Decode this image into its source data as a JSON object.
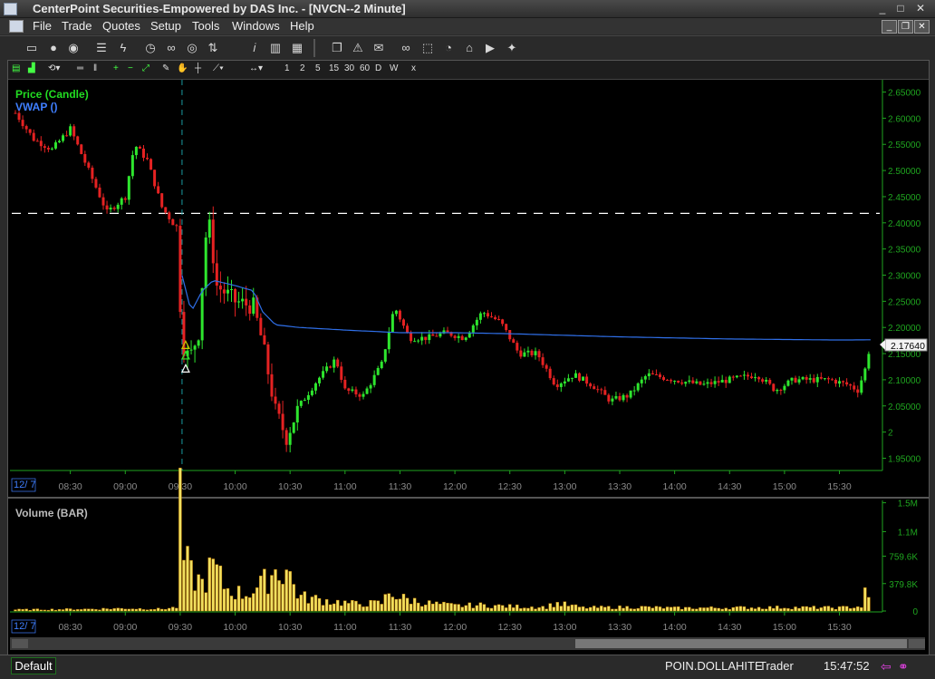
{
  "window": {
    "title": "CenterPoint Securities-Empowered by DAS Inc. - [NVCN--2 Minute]",
    "controls": [
      "_",
      "□",
      "✕"
    ]
  },
  "menu": [
    "File",
    "Trade",
    "Quotes",
    "Setup",
    "Tools",
    "Windows",
    "Help"
  ],
  "toolbar_icons": [
    "window-icon",
    "user-icon",
    "globe-icon",
    "list-icon",
    "lightning-icon",
    "clock-icon",
    "link-icon",
    "eye-icon",
    "sort-icon",
    "info-icon",
    "bar-chart-icon",
    "copy-icon",
    "alert-icon",
    "mail-icon",
    "binoculars-icon",
    "selection-icon",
    "timer-icon",
    "home-icon",
    "youtube-icon",
    "twitter-icon"
  ],
  "chart_toolbar": {
    "intervals": [
      "1",
      "2",
      "5",
      "15",
      "30",
      "60",
      "D",
      "W"
    ],
    "close": "x"
  },
  "colors": {
    "up": "#2ee62e",
    "down": "#e52222",
    "vwap": "#2f6fe8",
    "volume": "#f0e060",
    "axis": "#1fa51f",
    "legend_price": "#22dd22",
    "legend_vwap": "#3f7fff",
    "background": "#000000"
  },
  "price_pane": {
    "legend": [
      "Price (Candle)",
      "VWAP ()"
    ],
    "date_label": "12/ 7",
    "last_price": "2.17640",
    "dashed_level": 2.418,
    "crosshair_time": "09:31"
  },
  "volume_pane": {
    "legend": "Volume (BAR)",
    "date_label": "12/ 7"
  },
  "status": {
    "tab": "Default",
    "user": "POIN.DOLLAHITE",
    "role": "Trader",
    "time": "15:47:52"
  },
  "chart_data": [
    {
      "type": "candlestick",
      "series": [
        {
          "name": "Price (Candle)"
        },
        {
          "name": "VWAP ()"
        }
      ],
      "x_ticks": [
        "08:30",
        "09:00",
        "09:30",
        "10:00",
        "10:30",
        "11:00",
        "11:30",
        "12:00",
        "12:30",
        "13:00",
        "13:30",
        "14:00",
        "14:30",
        "15:00",
        "15:30"
      ],
      "y_ticks": [
        1.95,
        2,
        2.05,
        2.1,
        2.15,
        2.2,
        2.25,
        2.3,
        2.35,
        2.4,
        2.45,
        2.5,
        2.55,
        2.6,
        2.65
      ],
      "y_tick_labels": [
        "1.95000",
        "2",
        "2.05000",
        "2.10000",
        "2.15000",
        "2.20000",
        "2.25000",
        "2.30000",
        "2.35000",
        "2.40000",
        "2.45000",
        "2.50000",
        "2.55000",
        "2.60000",
        "2.65000"
      ],
      "ylim": [
        1.93,
        2.67
      ],
      "xlim": [
        "08:00",
        "15:52"
      ],
      "close_path": [
        [
          "08:00",
          2.61
        ],
        [
          "08:10",
          2.56
        ],
        [
          "08:20",
          2.54
        ],
        [
          "08:30",
          2.58
        ],
        [
          "08:40",
          2.5
        ],
        [
          "08:50",
          2.42
        ],
        [
          "09:00",
          2.45
        ],
        [
          "09:05",
          2.55
        ],
        [
          "09:12",
          2.52
        ],
        [
          "09:20",
          2.43
        ],
        [
          "09:28",
          2.39
        ],
        [
          "09:31",
          2.17
        ],
        [
          "09:35",
          2.14
        ],
        [
          "09:40",
          2.19
        ],
        [
          "09:45",
          2.42
        ],
        [
          "09:50",
          2.28
        ],
        [
          "10:00",
          2.25
        ],
        [
          "10:10",
          2.24
        ],
        [
          "10:15",
          2.17
        ],
        [
          "10:22",
          2.04
        ],
        [
          "10:28",
          1.99
        ],
        [
          "10:35",
          2.05
        ],
        [
          "10:45",
          2.1
        ],
        [
          "10:55",
          2.14
        ],
        [
          "11:00",
          2.08
        ],
        [
          "11:10",
          2.07
        ],
        [
          "11:20",
          2.13
        ],
        [
          "11:27",
          2.24
        ],
        [
          "11:35",
          2.18
        ],
        [
          "11:45",
          2.18
        ],
        [
          "11:55",
          2.19
        ],
        [
          "12:05",
          2.18
        ],
        [
          "12:15",
          2.23
        ],
        [
          "12:25",
          2.21
        ],
        [
          "12:35",
          2.15
        ],
        [
          "12:45",
          2.15
        ],
        [
          "12:55",
          2.09
        ],
        [
          "13:05",
          2.11
        ],
        [
          "13:15",
          2.09
        ],
        [
          "13:25",
          2.06
        ],
        [
          "13:35",
          2.07
        ],
        [
          "13:45",
          2.11
        ],
        [
          "14:00",
          2.1
        ],
        [
          "14:15",
          2.09
        ],
        [
          "14:30",
          2.1
        ],
        [
          "14:45",
          2.11
        ],
        [
          "14:55",
          2.08
        ],
        [
          "15:05",
          2.1
        ],
        [
          "15:15",
          2.1
        ],
        [
          "15:25",
          2.1
        ],
        [
          "15:35",
          2.09
        ],
        [
          "15:40",
          2.08
        ],
        [
          "15:44",
          2.12
        ],
        [
          "15:47",
          2.17
        ]
      ],
      "vwap": [
        [
          "09:31",
          2.3
        ],
        [
          "09:36",
          2.23
        ],
        [
          "09:42",
          2.27
        ],
        [
          "09:48",
          2.29
        ],
        [
          "10:00",
          2.28
        ],
        [
          "10:10",
          2.27
        ],
        [
          "10:15",
          2.23
        ],
        [
          "10:22",
          2.205
        ],
        [
          "10:35",
          2.2
        ],
        [
          "11:00",
          2.195
        ],
        [
          "11:30",
          2.19
        ],
        [
          "12:00",
          2.19
        ],
        [
          "12:30",
          2.188
        ],
        [
          "13:00",
          2.185
        ],
        [
          "13:30",
          2.182
        ],
        [
          "14:00",
          2.18
        ],
        [
          "14:30",
          2.178
        ],
        [
          "15:00",
          2.177
        ],
        [
          "15:30",
          2.176
        ],
        [
          "15:47",
          2.1764
        ]
      ]
    },
    {
      "type": "bar",
      "series": [
        {
          "name": "Volume (BAR)"
        }
      ],
      "y_ticks": [
        0,
        379800,
        759600,
        1100000,
        1500000
      ],
      "y_tick_labels": [
        "0",
        "379.8K",
        "759.6K",
        "1.1M",
        "1.5M"
      ],
      "ylim": [
        0,
        1520000
      ],
      "volume_profile": [
        [
          "08:00",
          20000
        ],
        [
          "08:40",
          30000
        ],
        [
          "09:00",
          40000
        ],
        [
          "09:20",
          30000
        ],
        [
          "09:29",
          60000
        ],
        [
          "09:30",
          1480000
        ],
        [
          "09:32",
          800000
        ],
        [
          "09:36",
          550000
        ],
        [
          "09:42",
          420000
        ],
        [
          "09:48",
          680000
        ],
        [
          "09:55",
          350000
        ],
        [
          "10:05",
          250000
        ],
        [
          "10:15",
          400000
        ],
        [
          "10:20",
          600000
        ],
        [
          "10:28",
          650000
        ],
        [
          "10:35",
          220000
        ],
        [
          "10:50",
          160000
        ],
        [
          "11:05",
          110000
        ],
        [
          "11:20",
          120000
        ],
        [
          "11:25",
          320000
        ],
        [
          "11:30",
          200000
        ],
        [
          "11:45",
          120000
        ],
        [
          "12:00",
          80000
        ],
        [
          "12:15",
          90000
        ],
        [
          "12:30",
          70000
        ],
        [
          "12:50",
          60000
        ],
        [
          "12:55",
          120000
        ],
        [
          "13:10",
          50000
        ],
        [
          "13:40",
          60000
        ],
        [
          "14:00",
          45000
        ],
        [
          "14:30",
          50000
        ],
        [
          "15:00",
          55000
        ],
        [
          "15:30",
          50000
        ],
        [
          "15:42",
          70000
        ],
        [
          "15:44",
          260000
        ],
        [
          "15:47",
          130000
        ]
      ]
    }
  ]
}
